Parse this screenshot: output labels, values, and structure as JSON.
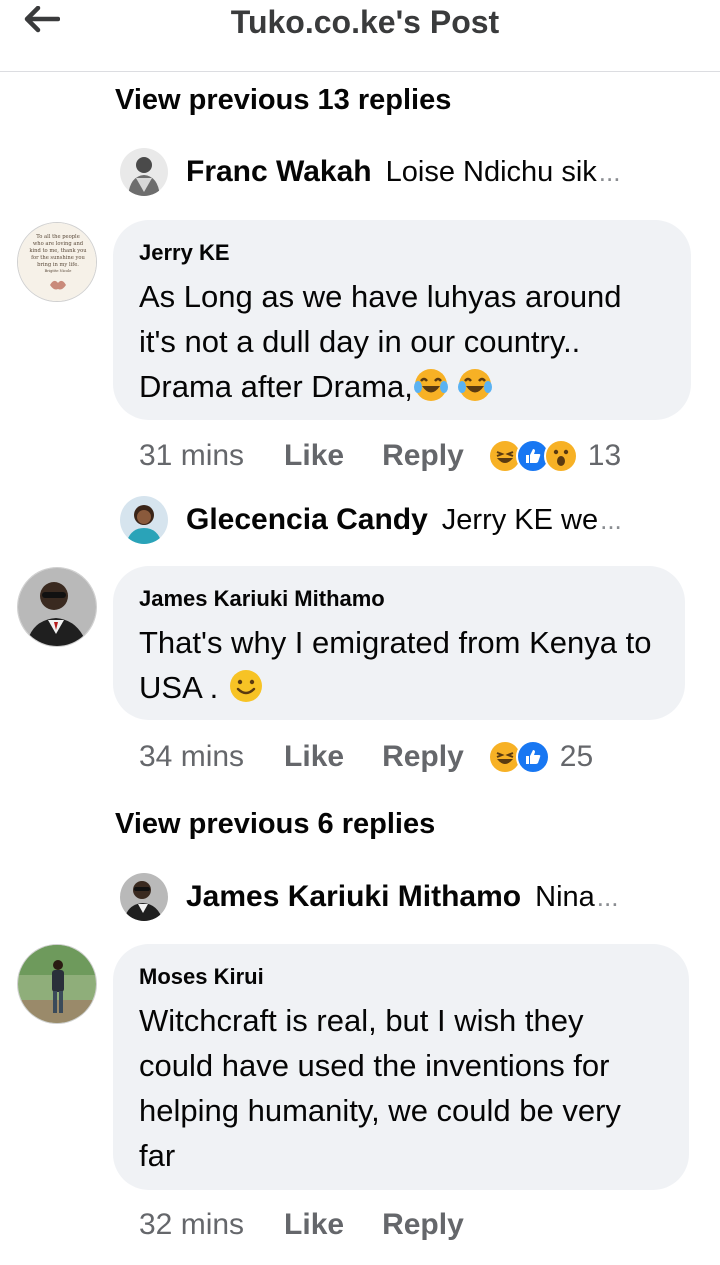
{
  "header": {
    "title": "Tuko.co.ke's Post",
    "back_icon": "back-arrow-icon"
  },
  "view_previous_1": "View previous 13 replies",
  "view_previous_2": "View previous 6 replies",
  "collapsed_replies": [
    {
      "name": "Franc Wakah",
      "text": "Loise Ndichu sik",
      "ellipsis": "..."
    },
    {
      "name": "Glecencia Candy",
      "text": "Jerry KE we",
      "ellipsis": "..."
    },
    {
      "name": "James Kariuki Mithamo",
      "text": "Nina",
      "ellipsis": "..."
    }
  ],
  "comments": [
    {
      "name": "Jerry KE",
      "text": "As Long as we have luhyas  around it's not a dull day in our country.. Drama after Drama,",
      "emojis": [
        "tears-of-joy-emoji",
        "tears-of-joy-emoji"
      ],
      "time": "31 mins",
      "like": "Like",
      "reply": "Reply",
      "reactions": [
        "haha-reaction-icon",
        "like-reaction-icon",
        "wow-reaction-icon"
      ],
      "reaction_count": "13",
      "avatar_lines": [
        "To all the people",
        "who are loving and",
        "kind to me, thank you",
        "for the sunshine you",
        "bring in my life.",
        "Brigitte Nicole"
      ]
    },
    {
      "name": "James Kariuki Mithamo",
      "text": "That's why I emigrated from Kenya to USA .",
      "emojis": [
        "smiley-emoji"
      ],
      "time": "34 mins",
      "like": "Like",
      "reply": "Reply",
      "reactions": [
        "haha-reaction-icon",
        "like-reaction-icon"
      ],
      "reaction_count": "25"
    },
    {
      "name": "Moses Kirui",
      "text": "Witchcraft is real, but I wish they could have used the inventions for helping humanity, we could be very far",
      "time": "32 mins",
      "like": "Like",
      "reply": "Reply"
    }
  ],
  "colors": {
    "bubble": "#f0f2f5",
    "meta": "#65676b",
    "text": "#050505",
    "like_blue": "#1877f2",
    "haha_yellow": "#f7b125"
  }
}
